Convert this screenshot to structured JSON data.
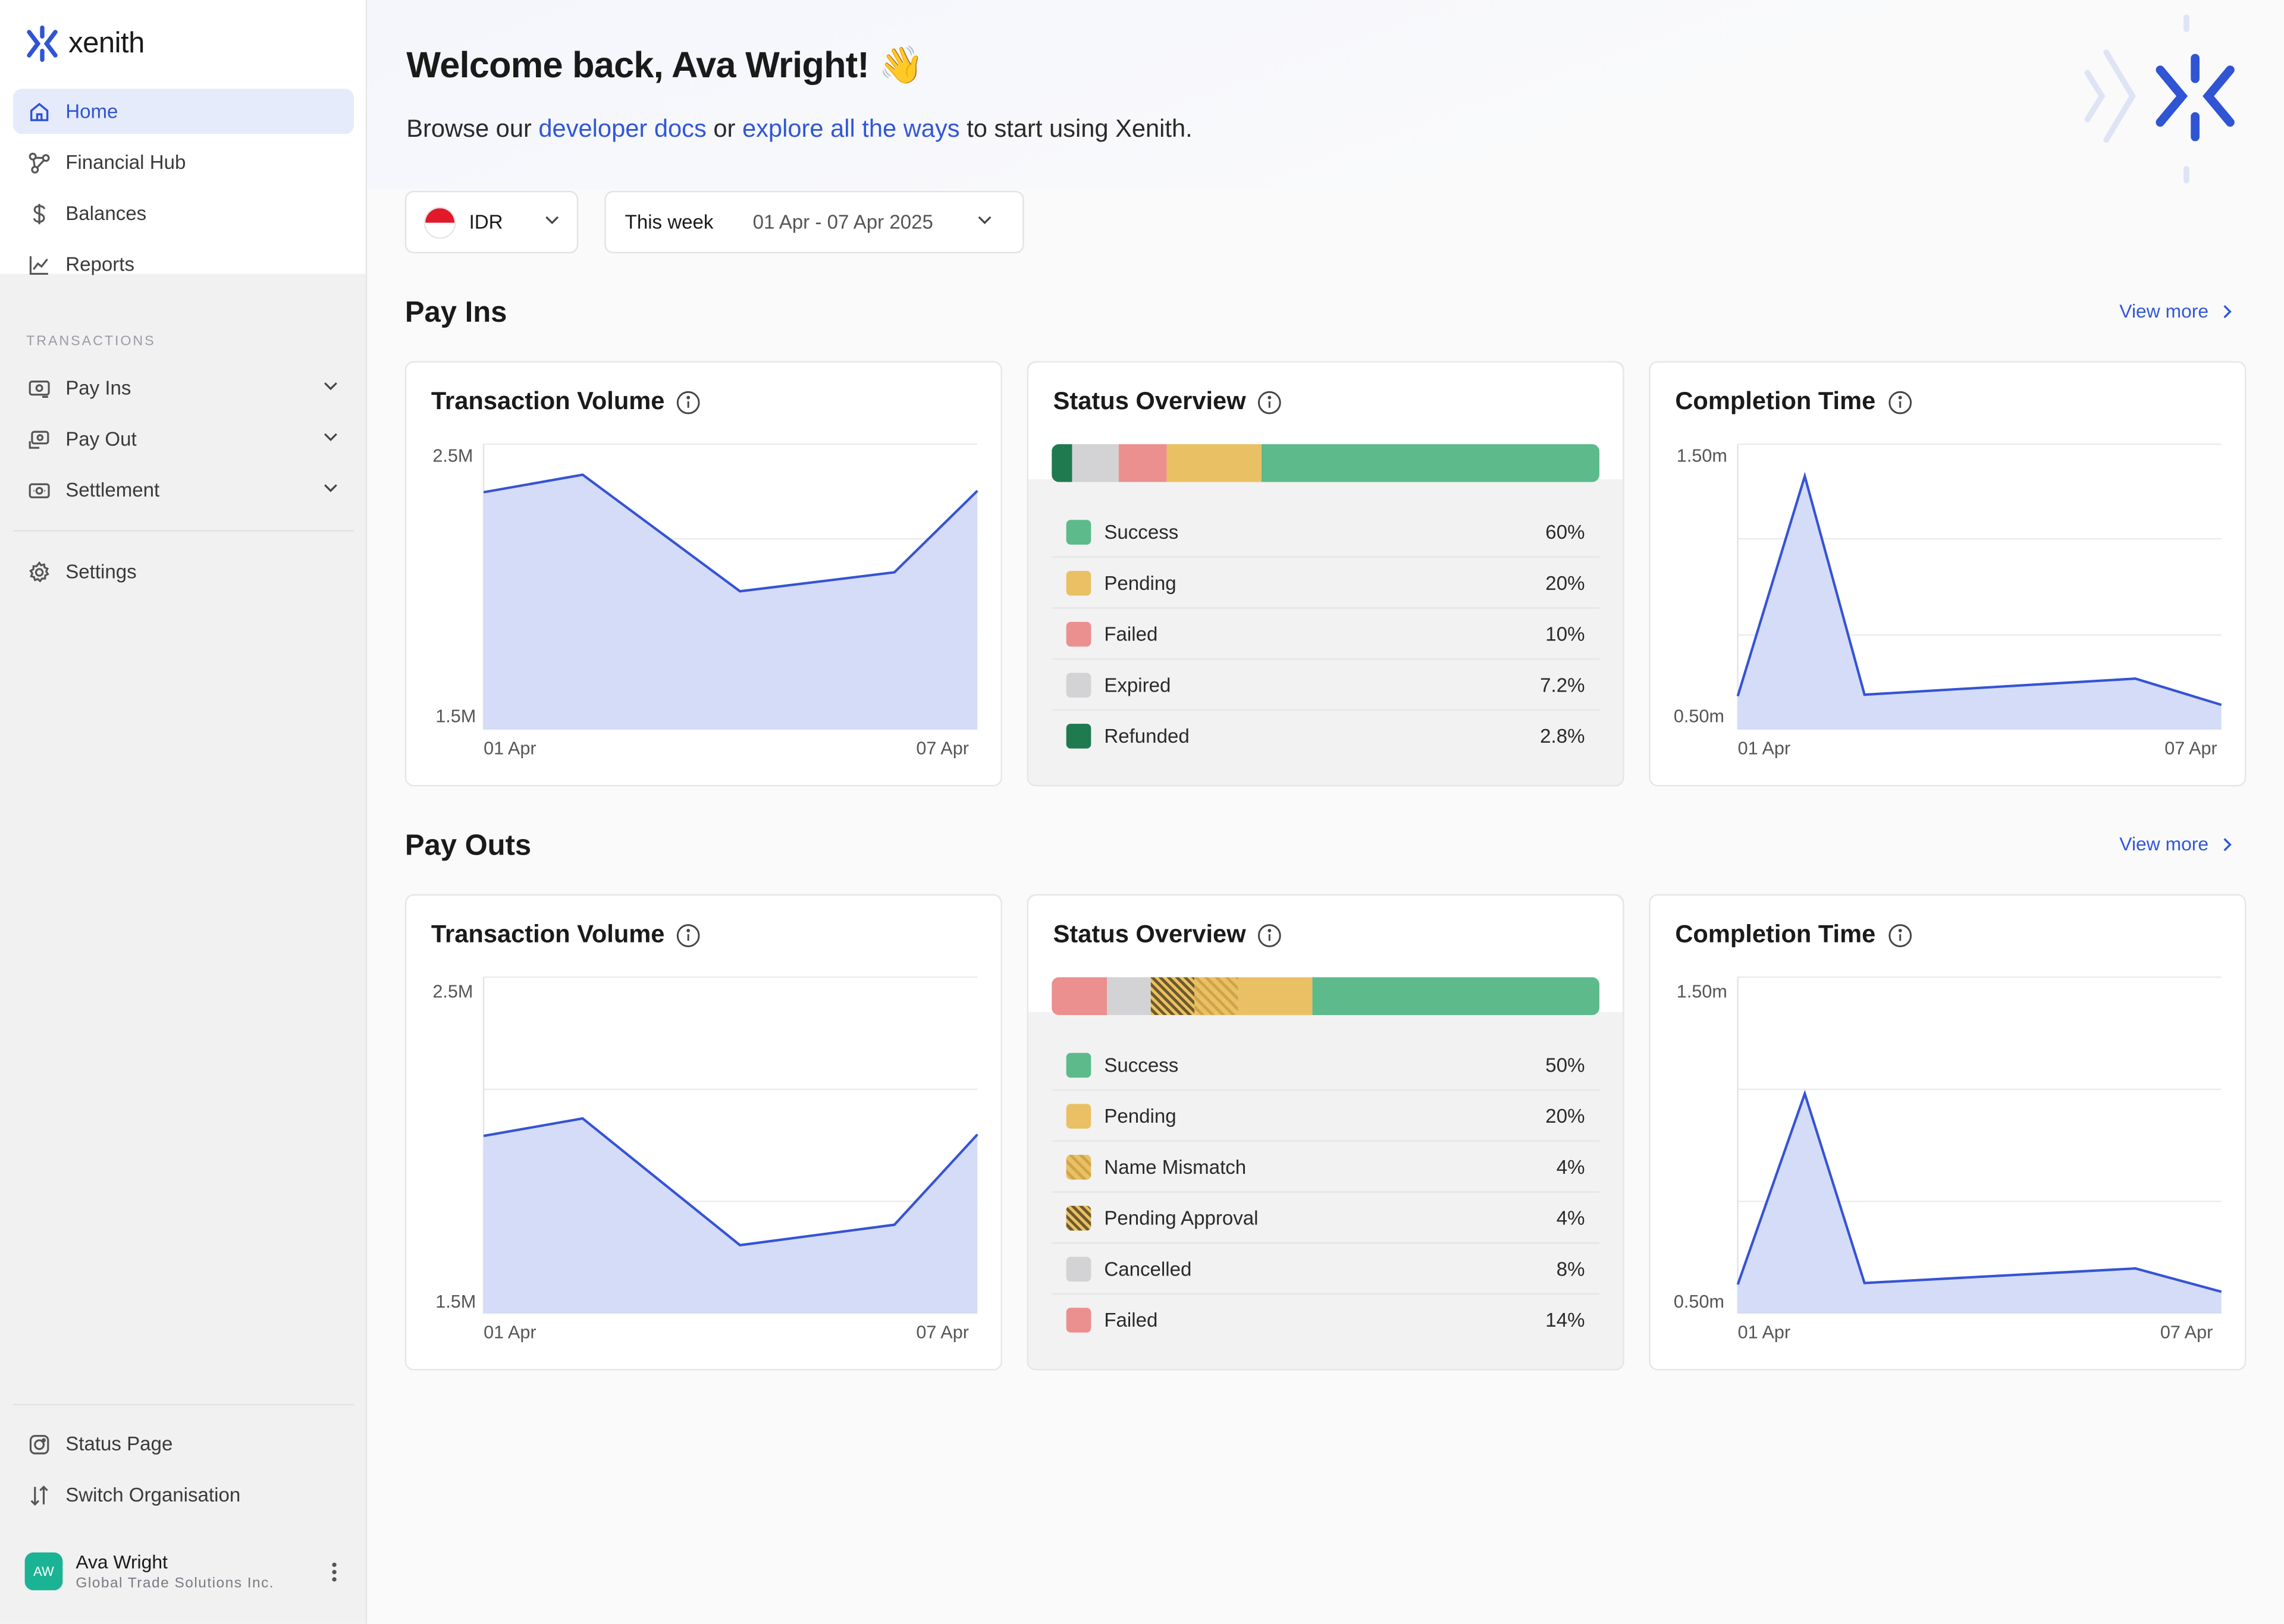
{
  "app": {
    "name": "xenith",
    "brand_color": "#2f54d4"
  },
  "sidebar": {
    "primary": [
      {
        "label": "Home",
        "icon": "home-icon",
        "active": true
      },
      {
        "label": "Financial Hub",
        "icon": "network-icon"
      },
      {
        "label": "Balances",
        "icon": "dollar-icon"
      },
      {
        "label": "Reports",
        "icon": "chart-line-icon"
      }
    ],
    "section_label": "TRANSACTIONS",
    "transactions": [
      {
        "label": "Pay Ins",
        "icon": "payin-icon"
      },
      {
        "label": "Pay Out",
        "icon": "payout-icon"
      },
      {
        "label": "Settlement",
        "icon": "cash-icon"
      }
    ],
    "settings": {
      "label": "Settings",
      "icon": "gear-icon"
    },
    "bottom": [
      {
        "label": "Status Page",
        "icon": "status-icon"
      },
      {
        "label": "Switch Organisation",
        "icon": "switch-arrows-icon"
      }
    ],
    "profile": {
      "initials": "AW",
      "name": "Ava Wright",
      "org": "Global Trade Solutions Inc."
    }
  },
  "header": {
    "welcome": "Welcome back, Ava Wright! 👋",
    "subtitle_prefix": "Browse our ",
    "link1": "developer docs",
    "subtitle_mid": " or ",
    "link2": "explore all the ways",
    "subtitle_suffix": " to start using Xenith."
  },
  "filters": {
    "currency": "IDR",
    "period": "This week",
    "date_range": "01 Apr - 07 Apr 2025"
  },
  "pay_ins": {
    "title": "Pay Ins",
    "view_more": "View more",
    "volume": {
      "title": "Transaction Volume",
      "y_top": "2.5M",
      "y_bottom": "1.5M",
      "x_start": "01 Apr",
      "x_end": "07 Apr"
    },
    "status": {
      "title": "Status Overview",
      "items": [
        {
          "label": "Success",
          "pct": "60%",
          "color": "#5dba8a"
        },
        {
          "label": "Pending",
          "pct": "20%",
          "color": "#e9c063"
        },
        {
          "label": "Failed",
          "pct": "10%",
          "color": "#ec8f8f"
        },
        {
          "label": "Expired",
          "pct": "7.2%",
          "color": "#d3d3d5"
        },
        {
          "label": "Refunded",
          "pct": "2.8%",
          "color": "#1f7a4f"
        }
      ]
    },
    "completion": {
      "title": "Completion Time",
      "y_top": "1.50m",
      "y_bottom": "0.50m",
      "x_start": "01 Apr",
      "x_end": "07 Apr"
    }
  },
  "pay_outs": {
    "title": "Pay Outs",
    "view_more": "View more",
    "volume": {
      "title": "Transaction Volume",
      "y_top": "2.5M",
      "y_bottom": "1.5M",
      "x_start": "01 Apr",
      "x_end": "07 Apr"
    },
    "status": {
      "title": "Status Overview",
      "items": [
        {
          "label": "Success",
          "pct": "50%",
          "color": "#5dba8a"
        },
        {
          "label": "Pending",
          "pct": "20%",
          "color": "#e9c063"
        },
        {
          "label": "Name Mismatch",
          "pct": "4%",
          "color": "hatch-light"
        },
        {
          "label": "Pending Approval",
          "pct": "4%",
          "color": "hatch-dark"
        },
        {
          "label": "Cancelled",
          "pct": "8%",
          "color": "#d3d3d5"
        },
        {
          "label": "Failed",
          "pct": "14%",
          "color": "#ec8f8f"
        }
      ]
    },
    "completion": {
      "title": "Completion Time",
      "y_top": "1.50m",
      "y_bottom": "0.50m",
      "x_start": "01 Apr",
      "x_end": "07 Apr"
    }
  },
  "chart_data": [
    {
      "type": "area",
      "title": "Transaction Volume",
      "series": [
        {
          "values": [
            2.35,
            2.48,
            2.0,
            1.96,
            2.15,
            2.36
          ]
        }
      ],
      "ylim": [
        1.5,
        2.5
      ]
    },
    {
      "type": "bar",
      "title": "Status Overview",
      "categories": [
        "Refunded",
        "Expired",
        "Failed",
        "Pending",
        "Success"
      ],
      "values": [
        2.8,
        7.2,
        10,
        20,
        60
      ]
    },
    {
      "type": "area",
      "title": "Completion Time",
      "series": [
        {
          "values": [
            0.6,
            1.45,
            0.6,
            0.65,
            0.68,
            0.72,
            0.6
          ]
        }
      ],
      "ylim": [
        0.5,
        1.5
      ]
    },
    {
      "type": "area",
      "title": "Transaction Volume",
      "series": [
        {
          "values": [
            2.15,
            2.2,
            1.78,
            1.75,
            1.82,
            2.15
          ]
        }
      ],
      "ylim": [
        1.5,
        2.5
      ]
    },
    {
      "type": "bar",
      "title": "Status Overview",
      "categories": [
        "Failed",
        "Cancelled",
        "Pending Approval",
        "Name Mismatch",
        "Pending",
        "Success"
      ],
      "values": [
        14,
        8,
        4,
        4,
        20,
        50
      ]
    },
    {
      "type": "area",
      "title": "Completion Time",
      "series": [
        {
          "values": [
            0.6,
            1.25,
            0.6,
            0.64,
            0.66,
            0.68,
            0.59
          ]
        }
      ],
      "ylim": [
        0.5,
        1.5
      ]
    }
  ]
}
